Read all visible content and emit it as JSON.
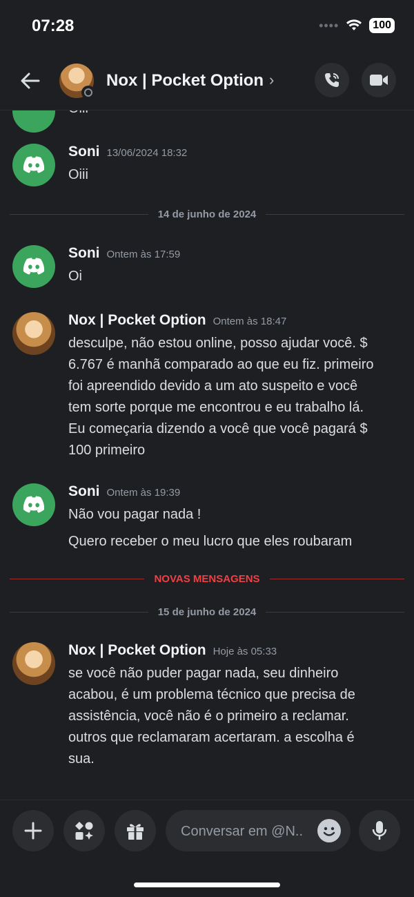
{
  "status_bar": {
    "time": "07:28",
    "battery": "100"
  },
  "header": {
    "title": "Nox | Pocket Option",
    "chevron": "›"
  },
  "partial_message": {
    "text": "Oiii"
  },
  "messages": [
    {
      "author": "Soni",
      "timestamp": "13/06/2024 18:32",
      "lines": [
        "Oiii"
      ]
    },
    {
      "author": "Soni",
      "timestamp": "Ontem às 17:59",
      "lines": [
        "Oi"
      ]
    },
    {
      "author": "Nox | Pocket Option",
      "timestamp": "Ontem às 18:47",
      "lines": [
        "desculpe, não estou online, posso ajudar você. $",
        "6.767 é manhã comparado ao que eu fiz. primeiro",
        "foi apreendido devido a um ato suspeito e você",
        "tem sorte porque me encontrou e eu trabalho lá.",
        "Eu começaria dizendo a você que você pagará $",
        "100 primeiro"
      ]
    },
    {
      "author": "Soni",
      "timestamp": "Ontem às 19:39",
      "lines": [
        "Não vou pagar nada !",
        "Quero receber o meu lucro que eles roubaram"
      ]
    },
    {
      "author": "Nox | Pocket Option",
      "timestamp": "Hoje às 05:33",
      "lines": [
        "se você não puder pagar nada, seu dinheiro",
        "acabou, é um problema técnico que precisa de",
        "assistência, você não é o primeiro a reclamar.",
        "outros que reclamaram acertaram. a escolha é",
        "sua."
      ]
    }
  ],
  "dividers": {
    "date1": "14 de junho de 2024",
    "new_messages": "NOVAS MENSAGENS",
    "date2": "15 de junho de 2024"
  },
  "composer": {
    "placeholder": "Conversar em @N.."
  }
}
